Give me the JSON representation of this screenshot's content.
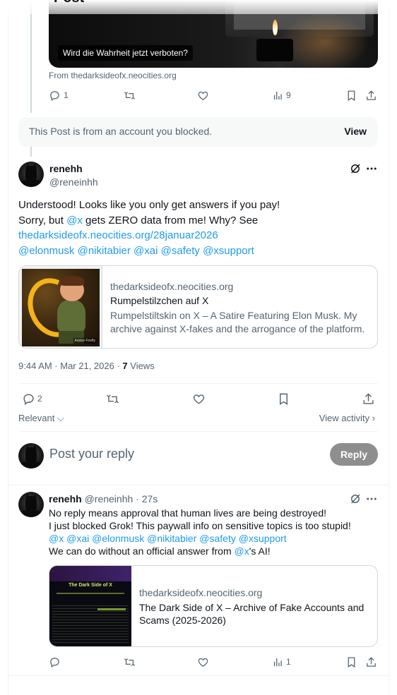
{
  "header": {
    "partial_title": "Post"
  },
  "quoted_post": {
    "media_caption": "Wird die Wahrheit jetzt verboten?",
    "source": "From thedarksideofx.neocities.org",
    "reply_count": "1",
    "repost_count": "",
    "like_count": "",
    "view_count": "9"
  },
  "blocked_notice": {
    "text": "This Post is from an account you blocked.",
    "action": "View"
  },
  "main_post": {
    "author_name": "renehh",
    "author_handle": "@reneinhh",
    "line1": "Understood! Looks like you only get answers if you pay!",
    "line2_pre": "Sorry, but ",
    "line2_mention": "@x",
    "line2_post": " gets ZERO data from me! Why? See",
    "link": "thedarksideofx.neocities.org/28januar2026",
    "mentions": [
      "@elonmusk",
      "@nikitabier",
      "@xai",
      "@safety",
      "@xsupport"
    ],
    "card": {
      "domain": "thedarksideofx.neocities.org",
      "title": "Rumpelstilzchen auf X",
      "description": "Rumpelstiltskin on X – A Satire Featuring Elon Musk. My archive against X-fakes and the arrogance of the platform.",
      "image_watermark": "Adobe Firefly"
    },
    "timestamp": "9:44 AM · Mar 21, 2026 · ",
    "views_count": "7",
    "views_label": " Views",
    "reply_count": "2"
  },
  "sort": {
    "label": "Relevant",
    "view_activity": "View activity"
  },
  "composer": {
    "placeholder": "Post your reply",
    "button": "Reply"
  },
  "reply_post": {
    "author_name": "renehh",
    "author_handle": "@reneinhh",
    "time": "· 27s",
    "line1": "No reply means approval that human lives are being destroyed!",
    "line2": "I just blocked Grok! This paywall info on sensitive topics is too stupid!",
    "mentions": [
      "@x",
      "@xai",
      "@elonmusk",
      "@nikitabier",
      "@safety",
      "@xsupport"
    ],
    "line4_pre": "We can do without an official answer from ",
    "line4_mention": "@x",
    "line4_post": "'s AI!",
    "card": {
      "domain": "thedarksideofx.neocities.org",
      "title": "The Dark Side of X – Archive of Fake Accounts and Scams (2025-2026)",
      "thumb_title": "The Dark Side of X"
    },
    "view_count": "1"
  },
  "colors": {
    "link": "#1d9bf0",
    "muted": "#536471",
    "text": "#0f1419",
    "reply_button": "#8e8e8e"
  }
}
